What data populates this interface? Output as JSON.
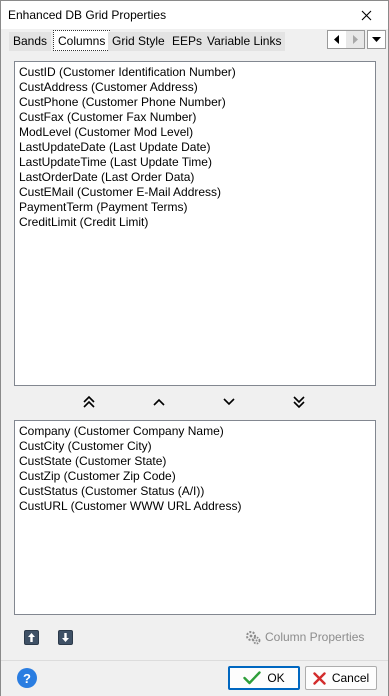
{
  "window": {
    "title": "Enhanced DB Grid Properties"
  },
  "tabs": [
    {
      "label": "Bands"
    },
    {
      "label": "Columns"
    },
    {
      "label": "Grid Style"
    },
    {
      "label": "EEPs"
    },
    {
      "label": "Variable Links"
    }
  ],
  "available_columns": [
    "CustID  (Customer Identification Number)",
    "CustAddress  (Customer Address)",
    "CustPhone  (Customer Phone Number)",
    "CustFax  (Customer Fax Number)",
    "ModLevel  (Customer Mod Level)",
    "LastUpdateDate  (Last Update Date)",
    "LastUpdateTime  (Last Update Time)",
    "LastOrderDate  (Last Order Data)",
    "CustEMail  (Customer E-Mail Address)",
    "PaymentTerm  (Payment Terms)",
    "CreditLimit  (Credit Limit)"
  ],
  "selected_columns": [
    "Company  (Customer Company Name)",
    "CustCity  (Customer City)",
    "CustState  (Customer State)",
    "CustZip  (Customer Zip Code)",
    "CustStatus  (Customer Status (A/I))",
    "CustURL  (Customer WWW URL Address)"
  ],
  "column_properties_label": "Column Properties",
  "buttons": {
    "ok": "OK",
    "cancel": "Cancel"
  },
  "colors": {
    "accent": "#0067c0",
    "help": "#2a7de1",
    "ok_check": "#2e9e3a",
    "cancel_x": "#d22c2c"
  }
}
